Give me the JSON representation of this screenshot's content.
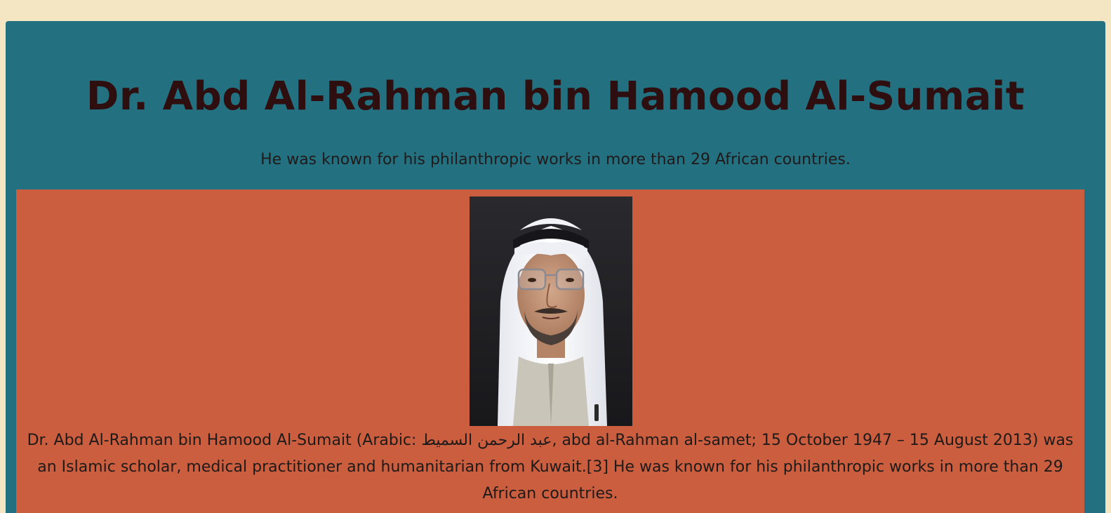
{
  "header": {
    "title": "Dr. Abd Al-Rahman bin Hamood Al-Sumait",
    "tagline": "He was known for his philanthropic works in more than 29 African countries."
  },
  "content": {
    "bio": {
      "part1": "Dr. Abd Al-Rahman bin Hamood Al-Sumait (Arabic: ",
      "arabic_name": "عبد الرحمن السميط",
      "part2": ", abd al-Rahman al-samet; 15 October 1947 – 15 August 2013) was an Islamic scholar, medical practitioner and humanitarian from Kuwait.[3] He was known for his philanthropic works in more than 29 African countries."
    }
  },
  "colors": {
    "page_background": "#f5e6c3",
    "header_background": "#237180",
    "content_background": "#cb5e3f",
    "title_text": "#2e0e0e",
    "body_text": "#1f1a1a"
  }
}
